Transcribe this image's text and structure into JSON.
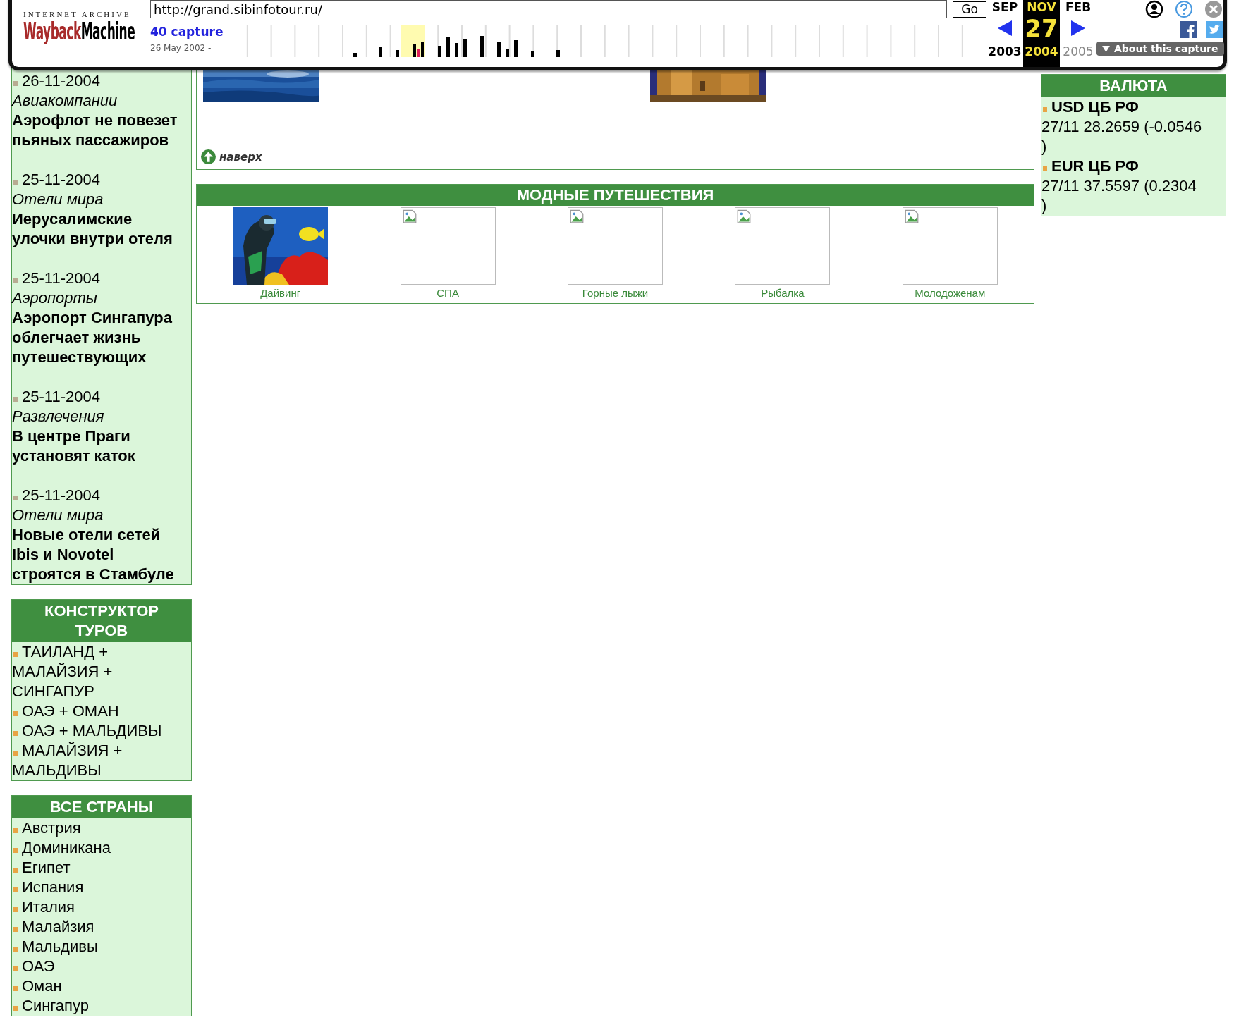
{
  "wayback_toolbar": {
    "logo": {
      "caption": "INTERNET ARCHIVE",
      "wordmark": [
        "Wayback",
        "Machine"
      ]
    },
    "url": "http://grand.sibinfotour.ru/",
    "go_button": "Go",
    "captures_link": "40 capture",
    "date_range": "26 May 2002 -",
    "calendar": [
      {
        "month": "SEP",
        "year": "2003",
        "selected": false,
        "year_disabled": false
      },
      {
        "month": "NOV",
        "day": "27",
        "year": "2004",
        "selected": true,
        "year_disabled": false
      },
      {
        "month": "FEB",
        "year": "2005",
        "selected": false,
        "year_disabled": true
      }
    ],
    "about_button": "About this capture"
  },
  "news": [
    {
      "date": "26-11-2004",
      "category": "Авиакомпании",
      "title": "Аэрофлот не повезет пьяных пассажиров"
    },
    {
      "date": "25-11-2004",
      "category": "Отели мира",
      "title": "Иерусалимские улочки внутри отеля"
    },
    {
      "date": "25-11-2004",
      "category": "Аэропорты",
      "title": "Аэропорт Сингапура облегчает жизнь путешествующих"
    },
    {
      "date": "25-11-2004",
      "category": "Развлечения",
      "title": "В центре Праги установят каток"
    },
    {
      "date": "25-11-2004",
      "category": "Отели мира",
      "title": "Новые отели сетей Ibis и Novotel строятся в Стамбуле"
    }
  ],
  "tour_builder": {
    "title": "КОНСТРУКТОР ТУРОВ",
    "items": [
      "ТАИЛАНД + МАЛАЙЗИЯ + СИНГАПУР",
      "ОАЭ + ОМАН",
      "ОАЭ + МАЛЬДИВЫ",
      "МАЛАЙЗИЯ + МАЛЬДИВЫ"
    ]
  },
  "countries": {
    "title": "ВСЕ СТРАНЫ",
    "items": [
      "Австрия",
      "Доминикана",
      "Египет",
      "Испания",
      "Италия",
      "Малайзия",
      "Мальдивы",
      "ОАЭ",
      "Оман",
      "Сингапур"
    ]
  },
  "back_to_top": "наверх",
  "fashion_travel": {
    "title": "МОДНЫЕ ПУТЕШЕСТВИЯ",
    "items": [
      {
        "label": "Дайвинг",
        "kind": "picture"
      },
      {
        "label": "СПА",
        "kind": "broken"
      },
      {
        "label": "Горные лыжи",
        "kind": "broken"
      },
      {
        "label": "Рыбалка",
        "kind": "broken"
      },
      {
        "label": "Молодоженам",
        "kind": "broken"
      }
    ]
  },
  "currency": {
    "title": "ВАЛЮТА",
    "rates": [
      {
        "name": "USD ЦБ РФ",
        "value": "27/11 28.2659 (-0.0546\n)"
      },
      {
        "name": "EUR ЦБ РФ",
        "value": "27/11 37.5597 (0.2304\n)"
      }
    ]
  }
}
